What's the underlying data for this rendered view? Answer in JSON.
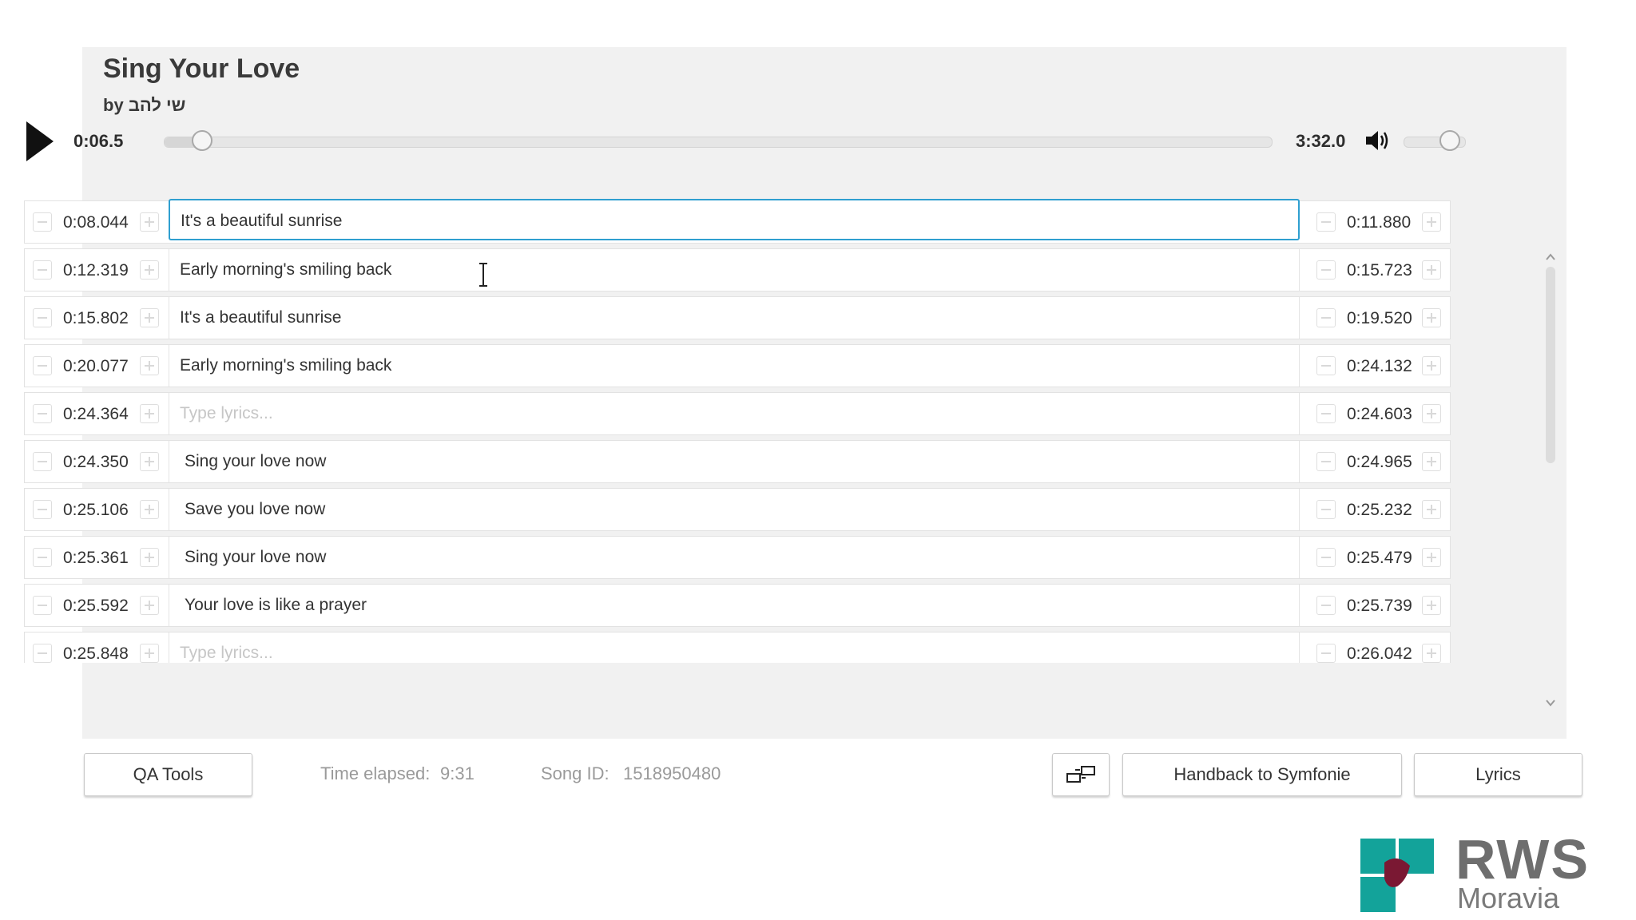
{
  "song": {
    "title": "Sing Your Love",
    "by_label": "by",
    "artist": "שי להב"
  },
  "player": {
    "current_time": "0:06.5",
    "total_time": "3:32.0",
    "progress": 0.034,
    "volume": 0.75
  },
  "rows": [
    {
      "start": "0:08.044",
      "lyric": "It's a beautiful sunrise",
      "end": "0:11.880",
      "placeholder": false,
      "focused": true
    },
    {
      "start": "0:12.319",
      "lyric": "Early morning's smiling back",
      "end": "0:15.723",
      "placeholder": false
    },
    {
      "start": "0:15.802",
      "lyric": "It's a beautiful sunrise",
      "end": "0:19.520",
      "placeholder": false
    },
    {
      "start": "0:20.077",
      "lyric": "Early morning's smiling back",
      "end": "0:24.132",
      "placeholder": false
    },
    {
      "start": "0:24.364",
      "lyric": "Type lyrics...",
      "end": "0:24.603",
      "placeholder": true
    },
    {
      "start": "0:24.350",
      "lyric": "Sing your love now",
      "end": "0:24.965",
      "placeholder": false
    },
    {
      "start": "0:25.106",
      "lyric": "Save you love now",
      "end": "0:25.232",
      "placeholder": false
    },
    {
      "start": "0:25.361",
      "lyric": "Sing your love now",
      "end": "0:25.479",
      "placeholder": false
    },
    {
      "start": "0:25.592",
      "lyric": "Your love is like a prayer",
      "end": "0:25.739",
      "placeholder": false
    },
    {
      "start": "0:25.848",
      "lyric": "Type lyrics...",
      "end": "0:26.042",
      "placeholder": true
    }
  ],
  "footer": {
    "qa_tools": "QA Tools",
    "time_elapsed_label": "Time elapsed:",
    "time_elapsed_value": "9:31",
    "song_id_label": "Song ID:",
    "song_id_value": "1518950480",
    "handback": "Handback to Symfonie",
    "lyrics": "Lyrics"
  },
  "logo": {
    "brand": "RWS",
    "sub": "Moravia",
    "colors": {
      "teal": "#13a39a",
      "maroon": "#7a1833"
    }
  },
  "colors": {
    "panel_bg": "#f1f1f1",
    "focus_border": "#2f9fd0"
  }
}
